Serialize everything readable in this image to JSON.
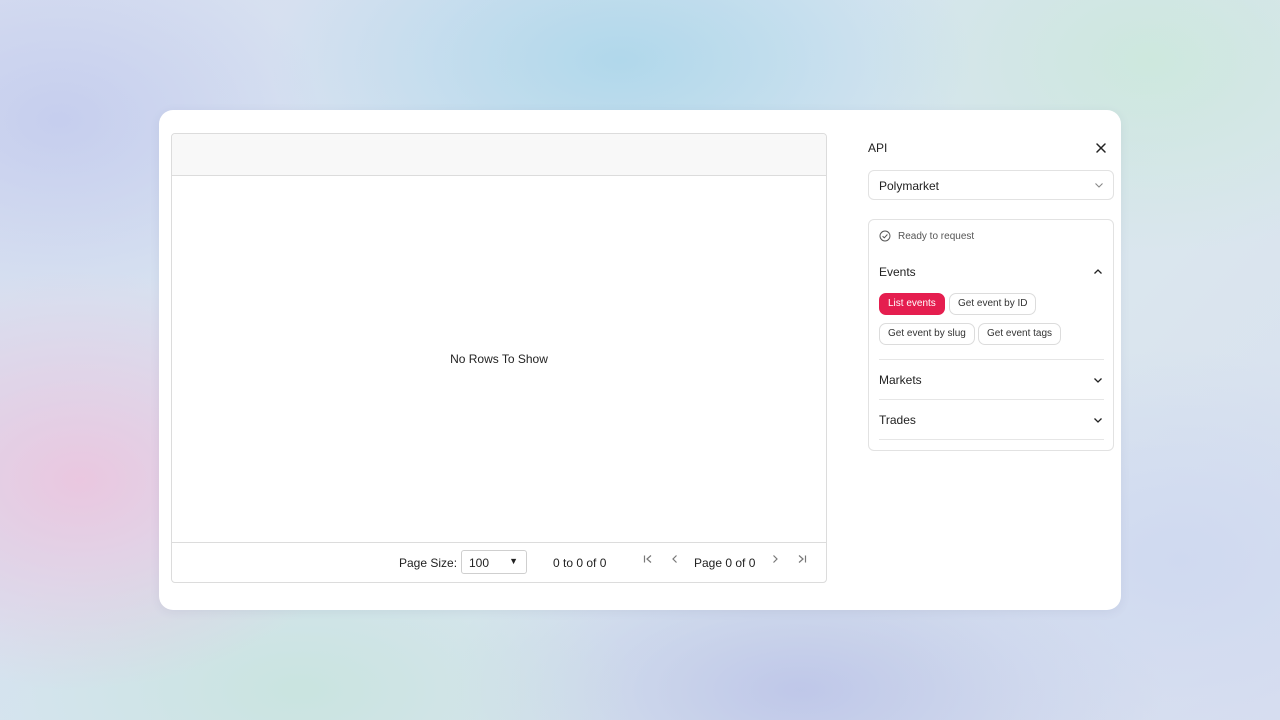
{
  "grid": {
    "empty_message": "No Rows To Show",
    "footer": {
      "page_size_label": "Page Size:",
      "page_size_value": "100",
      "range_text": "0 to 0 of 0",
      "page_text": "Page 0 of 0"
    }
  },
  "side_panel": {
    "title": "API",
    "api_select_value": "Polymarket",
    "status_text": "Ready to request",
    "sections": [
      {
        "title": "Events",
        "expanded": true,
        "endpoints": [
          "List events",
          "Get event by ID",
          "Get event by slug",
          "Get event tags"
        ],
        "active_endpoint": "List events"
      },
      {
        "title": "Markets",
        "expanded": false
      },
      {
        "title": "Trades",
        "expanded": false
      }
    ]
  },
  "colors": {
    "accent": "#e51e4f",
    "arrow": "#7ccf4a",
    "card_background": "#ffffff"
  },
  "icons": {
    "close": "close-icon",
    "select_chevron": "chevron-down-icon",
    "status": "check-circle-icon",
    "annotation": "curved-arrow-icon"
  }
}
